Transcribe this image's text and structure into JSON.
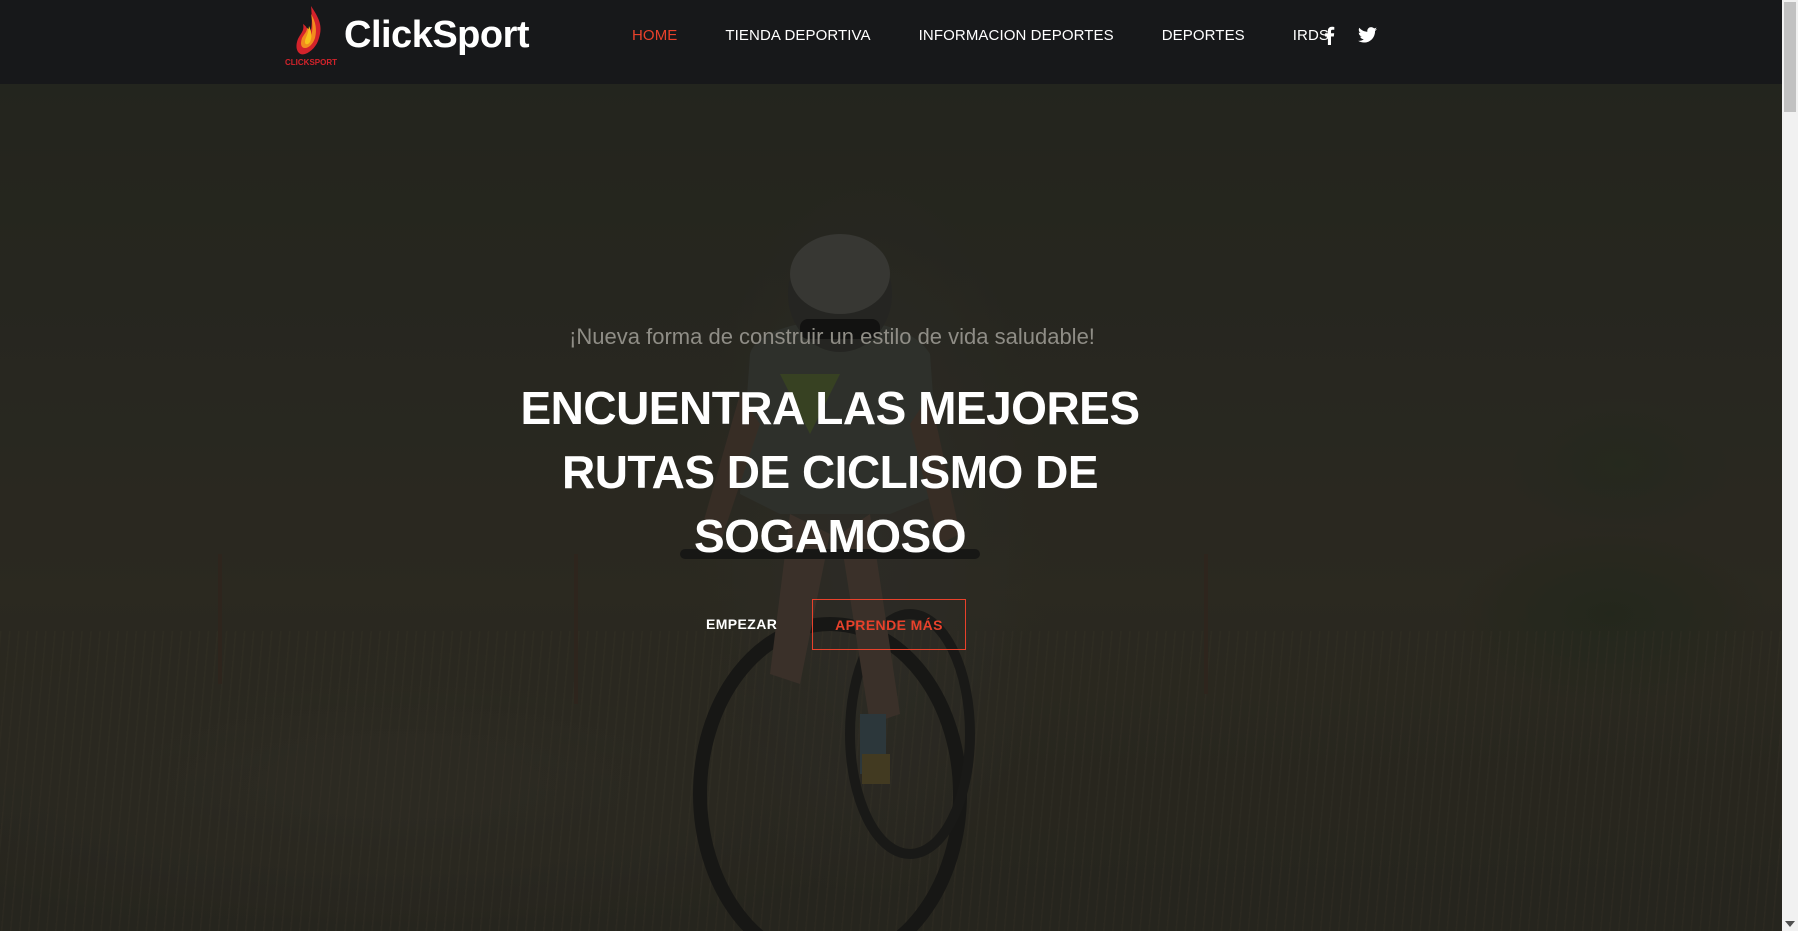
{
  "brand": {
    "name": "ClickSport",
    "logo_caption": "CLICKSPORT",
    "logo_icon": "flame-logo-icon",
    "colors": {
      "flame_red": "#d4232b",
      "flame_orange": "#f28c1e",
      "flame_yellow": "#f7c21b"
    }
  },
  "nav": {
    "items": [
      {
        "label": "HOME",
        "active": true
      },
      {
        "label": "TIENDA DEPORTIVA",
        "active": false
      },
      {
        "label": "INFORMACION DEPORTES",
        "active": false
      },
      {
        "label": "DEPORTES",
        "active": false
      },
      {
        "label": "IRDS",
        "active": false
      }
    ],
    "social": [
      {
        "icon": "facebook-icon"
      },
      {
        "icon": "twitter-icon"
      }
    ]
  },
  "hero": {
    "subtitle": "¡Nueva forma de construir un estilo de vida saludable!",
    "headline": "ENCUENTRA LAS MEJORES RUTAS DE CICLISMO DE SOGAMOSO",
    "primary_button": "EMPEZAR",
    "secondary_button": "APRENDE MÁS",
    "background": "mountain-biker-on-grass-field-photo"
  },
  "theme": {
    "accent": "#e8412b",
    "navbar_bg": "#17181a",
    "text": "#ffffff"
  }
}
